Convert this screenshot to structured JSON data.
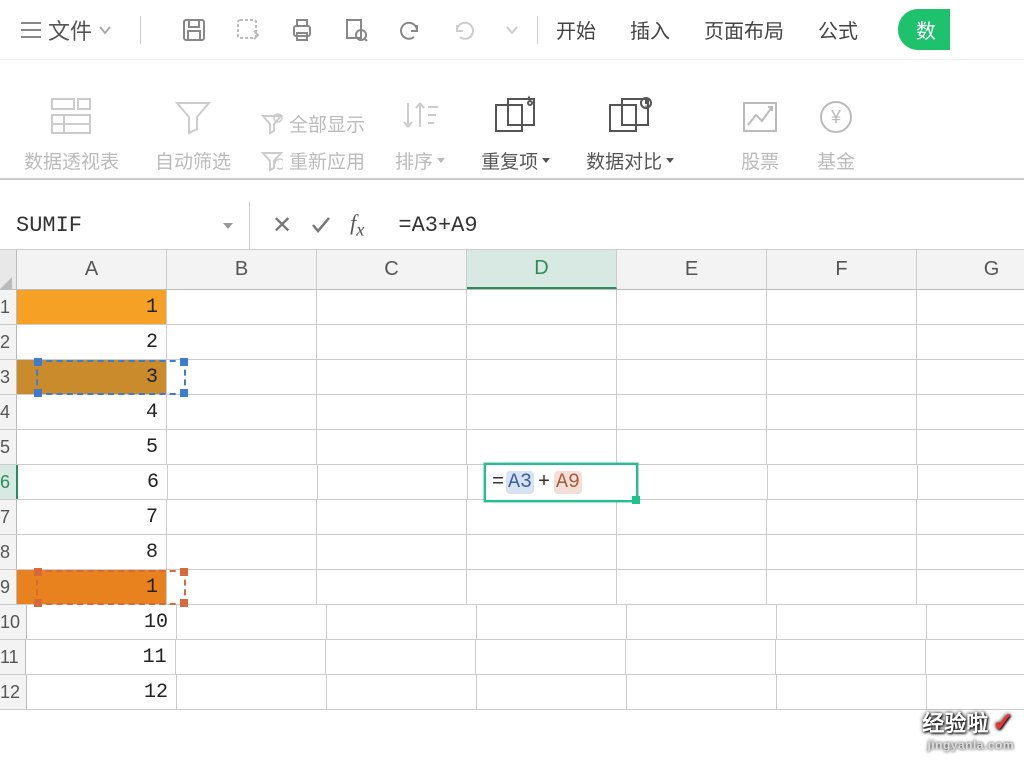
{
  "topbar": {
    "file_label": "文件",
    "menu": {
      "start": "开始",
      "insert": "插入",
      "layout": "页面布局",
      "formula": "公式",
      "data": "数"
    }
  },
  "ribbon": {
    "pivot": "数据透视表",
    "filter": "自动筛选",
    "show_all": "全部显示",
    "reapply": "重新应用",
    "sort": "排序",
    "dup": "重复项",
    "compare": "数据对比",
    "stock": "股票",
    "fund": "基金"
  },
  "formula_bar": {
    "name_box": "SUMIF",
    "formula": "=A3+A9"
  },
  "columns": [
    "A",
    "B",
    "C",
    "D",
    "E",
    "F",
    "G"
  ],
  "rows": [
    {
      "n": "1",
      "a": "1"
    },
    {
      "n": "2",
      "a": "2"
    },
    {
      "n": "3",
      "a": "3"
    },
    {
      "n": "4",
      "a": "4"
    },
    {
      "n": "5",
      "a": "5"
    },
    {
      "n": "6",
      "a": "6"
    },
    {
      "n": "7",
      "a": "7"
    },
    {
      "n": "8",
      "a": "8"
    },
    {
      "n": "9",
      "a": "1"
    },
    {
      "n": "10",
      "a": "10"
    },
    {
      "n": "11",
      "a": "11"
    },
    {
      "n": "12",
      "a": "12"
    }
  ],
  "edit_cell": {
    "eq": "=",
    "ref1": "A3",
    "plus": "+",
    "ref2": "A9"
  },
  "watermark": {
    "text": "经验啦",
    "url": "jingyanla.com"
  }
}
